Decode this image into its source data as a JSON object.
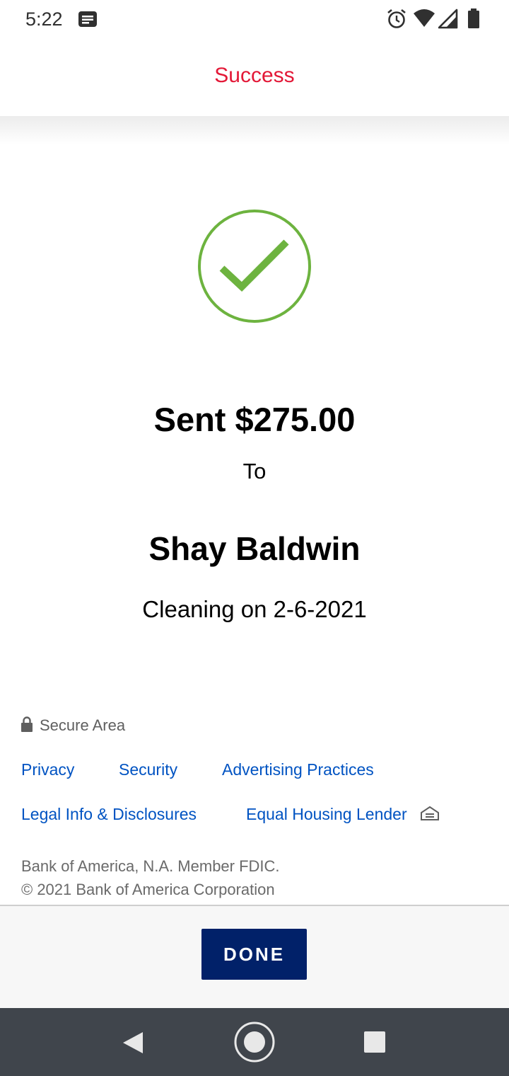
{
  "status_bar": {
    "time": "5:22",
    "icons": [
      "notification-icon",
      "alarm-icon",
      "wifi-icon",
      "signal-icon",
      "battery-icon"
    ]
  },
  "header": {
    "title": "Success"
  },
  "confirmation": {
    "icon": "checkmark-circle-icon",
    "amount_text": "Sent $275.00",
    "to_label": "To",
    "recipient": "Shay Baldwin",
    "memo": "Cleaning on 2-6-2021"
  },
  "footer": {
    "secure_label": "Secure Area",
    "links": {
      "privacy": "Privacy",
      "security": "Security",
      "advertising": "Advertising Practices",
      "legal": "Legal Info & Disclosures",
      "equal_housing": "Equal Housing Lender"
    },
    "legal_line1": "Bank of America, N.A. Member FDIC.",
    "legal_line2": "© 2021 Bank of America Corporation"
  },
  "actions": {
    "done_label": "DONE"
  },
  "colors": {
    "accent_red": "#e31837",
    "link_blue": "#0053c2",
    "button_navy": "#012169",
    "success_green": "#6db33f"
  }
}
